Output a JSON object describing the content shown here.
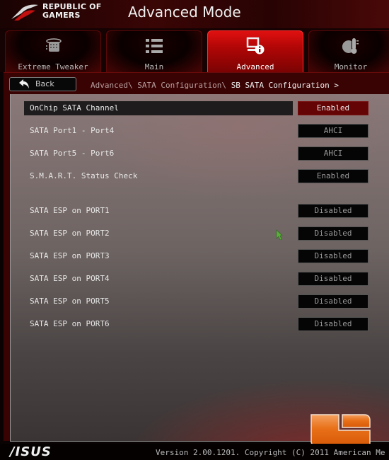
{
  "header": {
    "brand_line1": "REPUBLIC OF",
    "brand_line2": "GAMERS",
    "title": "Advanced Mode"
  },
  "tabs": [
    {
      "label": "Extreme Tweaker",
      "icon": "extreme-tweaker-icon",
      "active": false
    },
    {
      "label": "Main",
      "icon": "list-icon",
      "active": false
    },
    {
      "label": "Advanced",
      "icon": "advanced-info-icon",
      "active": true
    },
    {
      "label": "Monitor",
      "icon": "monitor-thermometer-icon",
      "active": false
    }
  ],
  "nav": {
    "back_label": "Back",
    "breadcrumb_path": "Advanced\\ SATA Configuration\\ ",
    "breadcrumb_current": "SB SATA Configuration >"
  },
  "settings": [
    {
      "label": "OnChip SATA Channel",
      "value": "Enabled",
      "selected": true
    },
    {
      "label": "SATA Port1 - Port4",
      "value": "AHCI"
    },
    {
      "label": "SATA Port5 - Port6",
      "value": "AHCI"
    },
    {
      "label": "S.M.A.R.T. Status Check",
      "value": "Enabled"
    },
    {
      "label": "SATA ESP on PORT1",
      "value": "Disabled"
    },
    {
      "label": "SATA ESP on PORT2",
      "value": "Disabled"
    },
    {
      "label": "SATA ESP on PORT3",
      "value": "Disabled"
    },
    {
      "label": "SATA ESP on PORT4",
      "value": "Disabled"
    },
    {
      "label": "SATA ESP on PORT5",
      "value": "Disabled"
    },
    {
      "label": "SATA ESP on PORT6",
      "value": "Disabled"
    }
  ],
  "footer": {
    "asus_logo": "/ISUS",
    "version": "Version 2.00.1201. Copyright (C) 2011 American Me"
  },
  "colors": {
    "accent_red": "#c00808",
    "selected_value_bg": "#640404",
    "watermark_orange": "#e86a10"
  }
}
